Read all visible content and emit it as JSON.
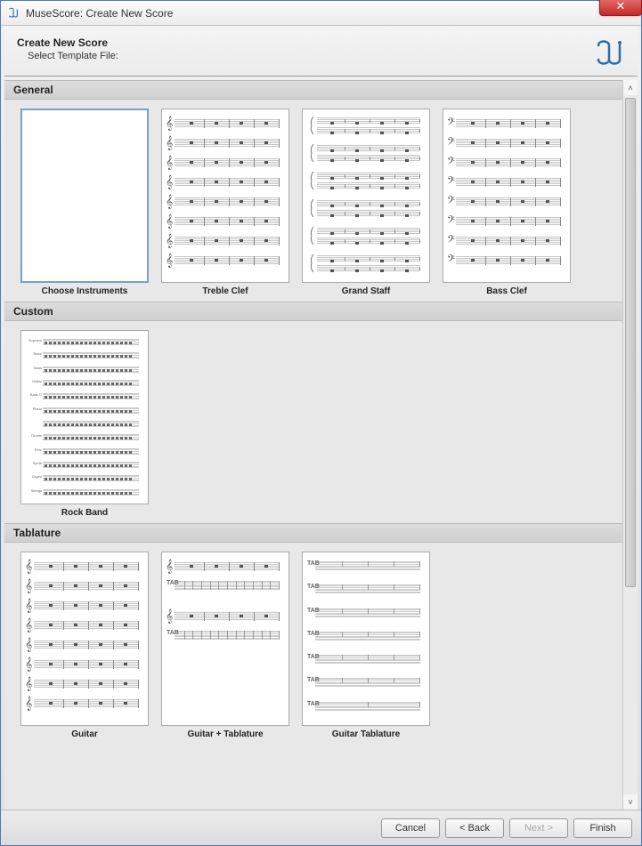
{
  "window": {
    "title": "MuseScore: Create New Score"
  },
  "header": {
    "title": "Create New Score",
    "subtitle": "Select Template File:"
  },
  "categories": [
    {
      "name": "General",
      "templates": [
        {
          "label": "Choose Instruments",
          "type": "blank"
        },
        {
          "label": "Treble Clef",
          "type": "treble"
        },
        {
          "label": "Grand Staff",
          "type": "grand"
        },
        {
          "label": "Bass Clef",
          "type": "bass"
        }
      ]
    },
    {
      "name": "Custom",
      "templates": [
        {
          "label": "Rock Band",
          "type": "rock"
        }
      ]
    },
    {
      "name": "Tablature",
      "templates": [
        {
          "label": "Guitar",
          "type": "treble"
        },
        {
          "label": "Guitar + Tablature",
          "type": "guitartab"
        },
        {
          "label": "Guitar Tablature",
          "type": "tabonly"
        }
      ]
    }
  ],
  "footer": {
    "cancel": "Cancel",
    "back": "< Back",
    "next": "Next >",
    "finish": "Finish"
  },
  "icons": {
    "close": "✕",
    "up": "˄",
    "down": "˅"
  }
}
